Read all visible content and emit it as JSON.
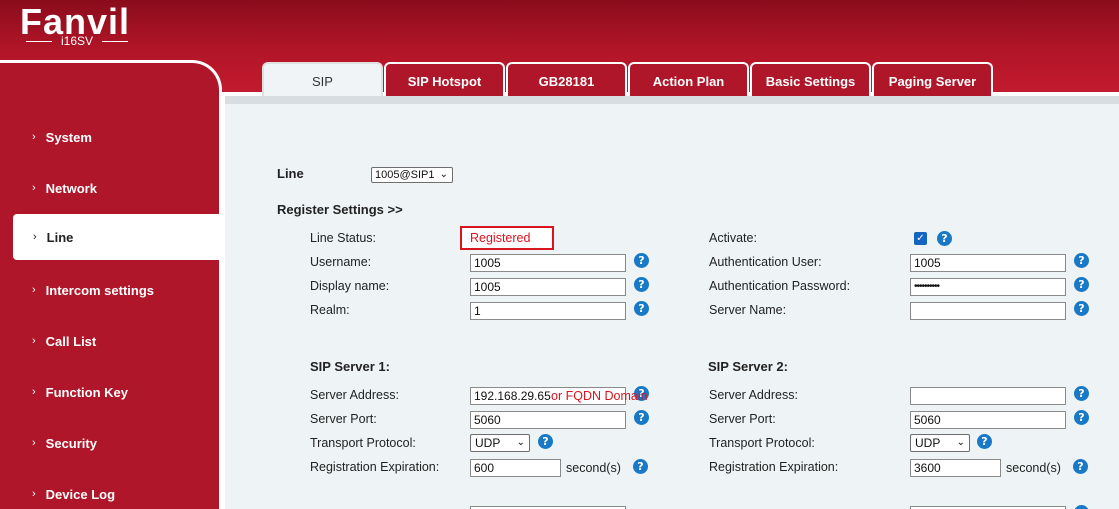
{
  "brand": {
    "logo": "Fanvil",
    "model": "i16SV"
  },
  "sidebar": {
    "items": [
      {
        "label": "System"
      },
      {
        "label": "Network"
      },
      {
        "label": "Line"
      },
      {
        "label": "Intercom settings"
      },
      {
        "label": "Call List"
      },
      {
        "label": "Function Key"
      },
      {
        "label": "Security"
      },
      {
        "label": "Device Log"
      }
    ],
    "active": "Line"
  },
  "tabs": [
    {
      "label": "SIP"
    },
    {
      "label": "SIP Hotspot"
    },
    {
      "label": "GB28181"
    },
    {
      "label": "Action Plan"
    },
    {
      "label": "Basic Settings"
    },
    {
      "label": "Paging Server"
    }
  ],
  "line": {
    "label": "Line",
    "selected": "1005@SIP1"
  },
  "register": {
    "heading": "Register Settings >>",
    "line_status_label": "Line Status:",
    "line_status_value": "Registered",
    "username_label": "Username:",
    "username_value": "1005",
    "display_name_label": "Display name:",
    "display_name_value": "1005",
    "realm_label": "Realm:",
    "realm_value": "1",
    "activate_label": "Activate:",
    "auth_user_label": "Authentication User:",
    "auth_user_value": "1005",
    "auth_password_label": "Authentication Password:",
    "auth_password_value": "••••••••••",
    "server_name_label": "Server Name:",
    "server_name_value": ""
  },
  "sip_server_1": {
    "heading": "SIP Server 1:",
    "address_label": "Server Address:",
    "address_value": "192.168.29.65",
    "address_hint": "or FQDN Domain",
    "port_label": "Server Port:",
    "port_value": "5060",
    "transport_label": "Transport Protocol:",
    "transport_value": "UDP",
    "expiration_label": "Registration Expiration:",
    "expiration_value": "600",
    "expiration_unit": "second(s)"
  },
  "sip_server_2": {
    "heading": "SIP Server 2:",
    "address_label": "Server Address:",
    "address_value": "",
    "port_label": "Server Port:",
    "port_value": "5060",
    "transport_label": "Transport Protocol:",
    "transport_value": "UDP",
    "expiration_label": "Registration Expiration:",
    "expiration_value": "3600",
    "expiration_unit": "second(s)"
  },
  "help_glyph": "?",
  "checkmark_glyph": "✓",
  "chevron_glyph": "›",
  "caret_glyph": "⌄",
  "colors": {
    "brand_red": "#b0162a",
    "status_red": "#d9141f",
    "help_blue": "#1a79c7",
    "content_bg": "#eef4f6"
  }
}
